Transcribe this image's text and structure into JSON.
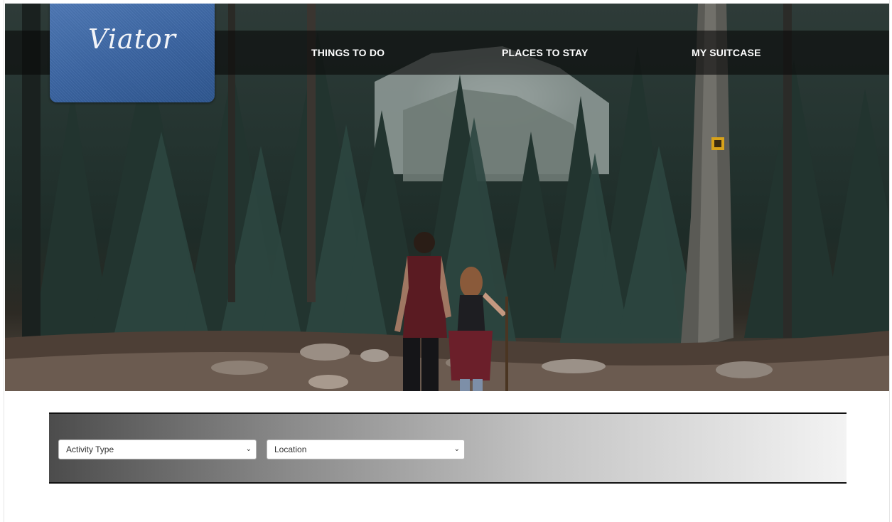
{
  "brand": {
    "logo_text": "Viator",
    "accent_color": "#3c66a3"
  },
  "nav": {
    "items": [
      {
        "label": "THINGS TO DO"
      },
      {
        "label": "PLACES TO STAY"
      },
      {
        "label": "MY SUITCASE"
      }
    ]
  },
  "filters": {
    "activity": {
      "selected": "Activity Type"
    },
    "location": {
      "selected": "Location"
    }
  },
  "icons": {
    "dropdown": "chevron-down-icon"
  }
}
